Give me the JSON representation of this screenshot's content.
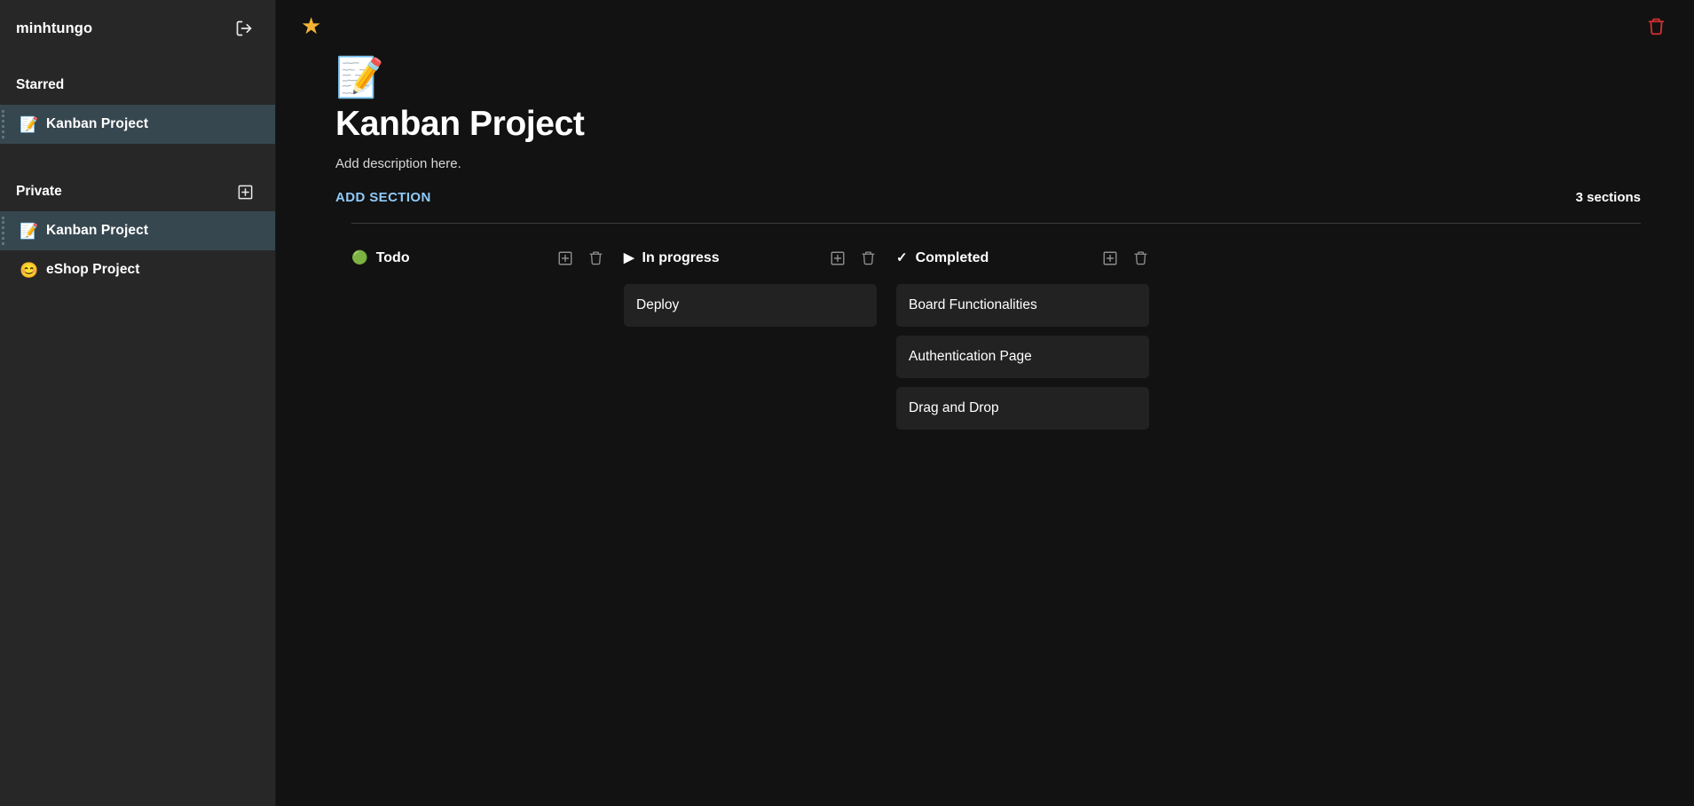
{
  "sidebar": {
    "username": "minhtungo",
    "logout_icon": "logout-icon",
    "groups": [
      {
        "label": "Starred",
        "has_add_button": false,
        "items": [
          {
            "emoji": "📝",
            "icon_name": "memo-icon",
            "label": "Kanban Project",
            "selected": true
          }
        ]
      },
      {
        "label": "Private",
        "has_add_button": true,
        "add_icon": "add-box-icon",
        "items": [
          {
            "emoji": "📝",
            "icon_name": "memo-icon",
            "label": "Kanban Project",
            "selected": true
          },
          {
            "emoji": "😊",
            "icon_name": "smiling-face-icon",
            "label": "eShop Project",
            "selected": false
          }
        ]
      }
    ]
  },
  "topbar": {
    "star_glyph": "★",
    "star_icon": "star-favorite-icon",
    "delete_icon": "delete-board-icon"
  },
  "board": {
    "emoji": "📝",
    "emoji_icon_name": "memo-icon",
    "title": "Kanban Project",
    "description": "Add description here.",
    "add_section_label": "ADD SECTION",
    "sections_count_label": "3 sections",
    "accent_color": "#90caf9",
    "delete_color": "#d32f2f",
    "star_color": "#f5b335"
  },
  "columns": [
    {
      "emoji": "🟢",
      "emoji_icon_name": "green-circle-icon",
      "title": "Todo",
      "add_icon": "add-task-icon",
      "delete_icon": "delete-section-icon",
      "tasks": []
    },
    {
      "emoji": "▶",
      "emoji_icon_name": "play-triangle-icon",
      "title": "In progress",
      "add_icon": "add-task-icon",
      "delete_icon": "delete-section-icon",
      "tasks": [
        {
          "title": "Deploy"
        }
      ]
    },
    {
      "emoji": "✓",
      "emoji_icon_name": "check-mark-icon",
      "title": "Completed",
      "add_icon": "add-task-icon",
      "delete_icon": "delete-section-icon",
      "tasks": [
        {
          "title": "Board Functionalities"
        },
        {
          "title": "Authentication Page"
        },
        {
          "title": "Drag and Drop"
        }
      ]
    }
  ]
}
